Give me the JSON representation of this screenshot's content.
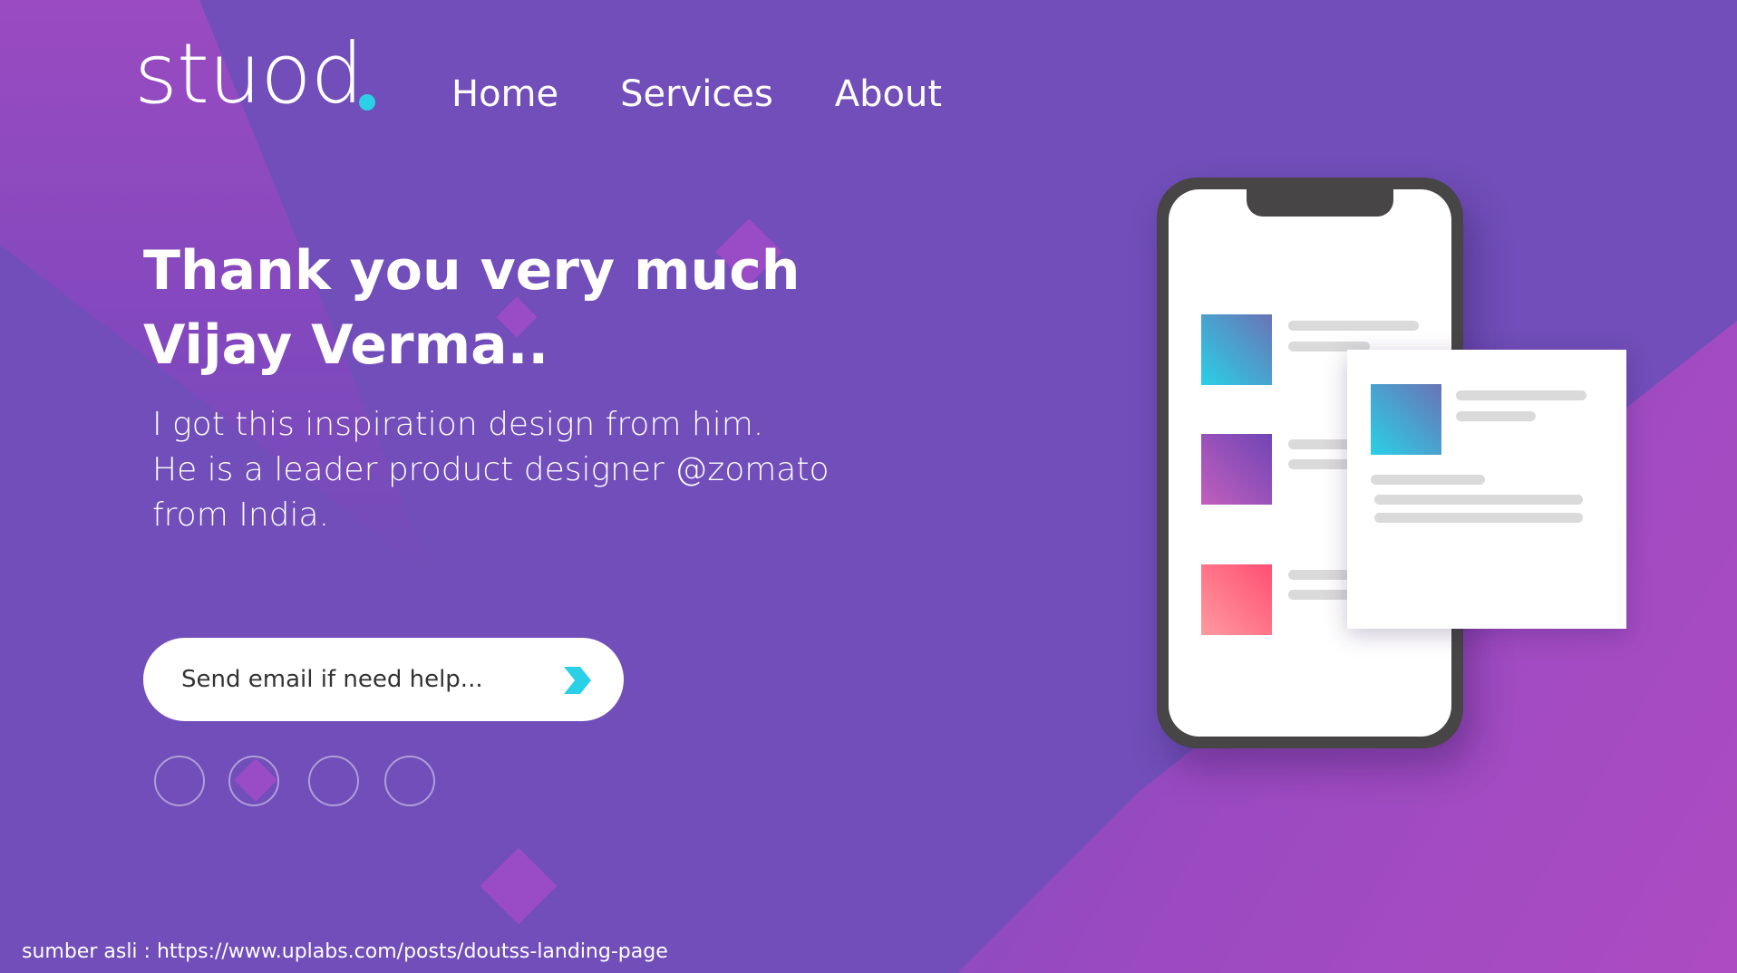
{
  "header": {
    "logo_text": "stuod",
    "nav": [
      {
        "label": "Home"
      },
      {
        "label": "Services"
      },
      {
        "label": "About"
      }
    ]
  },
  "hero": {
    "title_line1": "Thank you very much",
    "title_line2": "Vijay Verma..",
    "description_lines": [
      "I got this inspiration design from him.",
      "He is a leader product designer @zomato",
      "from India."
    ]
  },
  "email": {
    "placeholder": "Send email if need help...",
    "send_icon": "chevron-right-icon"
  },
  "carousel": {
    "dot_count": 4
  },
  "illustration": {
    "phone_tiles": [
      {
        "gradient": [
          "#2ad0e6",
          "#6a73b6"
        ]
      },
      {
        "gradient": [
          "#c15fbd",
          "#7145b5"
        ]
      },
      {
        "gradient": [
          "#ff9a9e",
          "#ff4f73"
        ]
      }
    ],
    "card_tile": {
      "gradient": [
        "#2ad0e6",
        "#6a73b6"
      ]
    }
  },
  "footer": {
    "credit": "sumber asli : https://www.uplabs.com/posts/doutss-landing-page"
  },
  "colors": {
    "background": "#714eb9",
    "accent_cyan": "#2ad0e6",
    "phone_frame": "#474545"
  }
}
